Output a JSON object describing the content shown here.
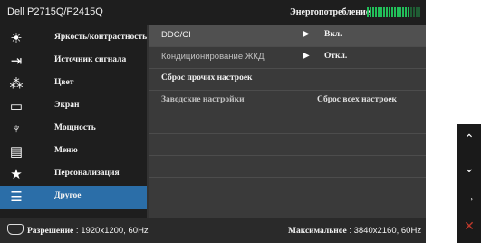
{
  "header": {
    "model": "Dell P2715Q/P2415Q",
    "energy_label": "Энергопотребление",
    "energy_level": 0.8,
    "colors": {
      "on": "#22c05a",
      "off": "#1f5c34"
    }
  },
  "sidebar": {
    "items": [
      {
        "label": "Яркость/контрастность",
        "icon": "brightness-icon",
        "glyph": "☀"
      },
      {
        "label": "Источник сигнала",
        "icon": "input-source-icon",
        "glyph": "⇥"
      },
      {
        "label": "Цвет",
        "icon": "color-icon",
        "glyph": "⁂"
      },
      {
        "label": "Экран",
        "icon": "display-icon",
        "glyph": "▭"
      },
      {
        "label": "Мощность",
        "icon": "power-icon",
        "glyph": "♆"
      },
      {
        "label": "Меню",
        "icon": "menu-icon",
        "glyph": "▤"
      },
      {
        "label": "Персонализация",
        "icon": "star-icon",
        "glyph": "★"
      },
      {
        "label": "Другое",
        "icon": "other-settings-icon",
        "glyph": "☰",
        "active": true
      }
    ]
  },
  "content": {
    "rows": [
      {
        "label": "DDC/CI",
        "value": "Вкл."
      },
      {
        "label": "Кондиционирование ЖКД",
        "value": "Откл."
      },
      {
        "label": "Сброс прочих настроек"
      },
      {
        "label": "Заводские настройки",
        "right": "Сброс всех настроек"
      }
    ]
  },
  "footer": {
    "resolution_label": "Разрешение",
    "resolution_value": ": 1920x1200, 60Hz",
    "max_label": "Максимальное",
    "max_value": ": 3840x2160, 60Hz"
  },
  "keys": [
    {
      "name": "up-key",
      "glyph": "⌃",
      "color": "#ffffff"
    },
    {
      "name": "down-key",
      "glyph": "⌄",
      "color": "#ffffff"
    },
    {
      "name": "enter-key",
      "glyph": "→",
      "color": "#ffffff"
    },
    {
      "name": "exit-key",
      "glyph": "✕",
      "color": "#c0392b"
    }
  ]
}
